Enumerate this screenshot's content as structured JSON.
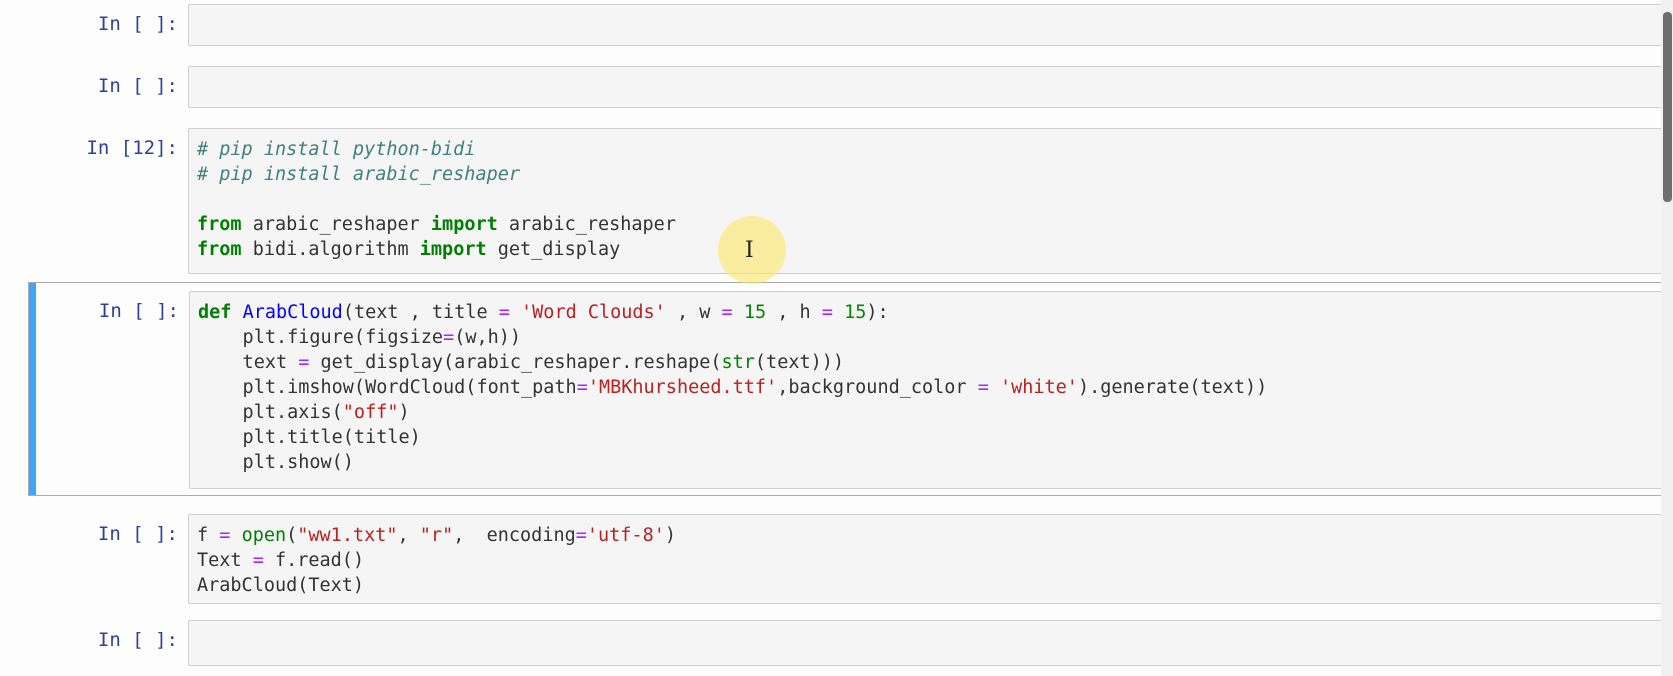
{
  "cells": [
    {
      "prompt": "In [ ]:",
      "lines": []
    },
    {
      "prompt": "In [ ]:",
      "lines": []
    },
    {
      "prompt": "In [12]:",
      "lines": [
        [
          {
            "t": "# pip install python-bidi",
            "c": "comment"
          }
        ],
        [
          {
            "t": "# pip install arabic_reshaper",
            "c": "comment"
          }
        ],
        [
          {
            "t": "",
            "c": ""
          }
        ],
        [
          {
            "t": "from",
            "c": "keyword"
          },
          {
            "t": " arabic_reshaper ",
            "c": ""
          },
          {
            "t": "import",
            "c": "keyword"
          },
          {
            "t": " arabic_reshaper",
            "c": ""
          }
        ],
        [
          {
            "t": "from",
            "c": "keyword"
          },
          {
            "t": " bidi.algorithm ",
            "c": ""
          },
          {
            "t": "import",
            "c": "keyword"
          },
          {
            "t": " get_display",
            "c": ""
          }
        ]
      ]
    },
    {
      "prompt": "In [ ]:",
      "selected": true,
      "lines": [
        [
          {
            "t": "def",
            "c": "keyword"
          },
          {
            "t": " ",
            "c": ""
          },
          {
            "t": "ArabCloud",
            "c": "def"
          },
          {
            "t": "(text , title ",
            "c": ""
          },
          {
            "t": "=",
            "c": "op"
          },
          {
            "t": " ",
            "c": ""
          },
          {
            "t": "'Word Clouds'",
            "c": "string"
          },
          {
            "t": " , w ",
            "c": ""
          },
          {
            "t": "=",
            "c": "op"
          },
          {
            "t": " ",
            "c": ""
          },
          {
            "t": "15",
            "c": "number"
          },
          {
            "t": " , h ",
            "c": ""
          },
          {
            "t": "=",
            "c": "op"
          },
          {
            "t": " ",
            "c": ""
          },
          {
            "t": "15",
            "c": "number"
          },
          {
            "t": "):",
            "c": ""
          }
        ],
        [
          {
            "t": "    plt.figure(figsize",
            "c": ""
          },
          {
            "t": "=",
            "c": "op"
          },
          {
            "t": "(w,h))",
            "c": ""
          }
        ],
        [
          {
            "t": "    text ",
            "c": ""
          },
          {
            "t": "=",
            "c": "op"
          },
          {
            "t": " get_display(arabic_reshaper.reshape(",
            "c": ""
          },
          {
            "t": "str",
            "c": "builtin"
          },
          {
            "t": "(text)))",
            "c": ""
          }
        ],
        [
          {
            "t": "    plt.imshow(WordCloud(font_path",
            "c": ""
          },
          {
            "t": "=",
            "c": "op"
          },
          {
            "t": "'MBKhursheed.ttf'",
            "c": "string"
          },
          {
            "t": ",background_color ",
            "c": ""
          },
          {
            "t": "=",
            "c": "op"
          },
          {
            "t": " ",
            "c": ""
          },
          {
            "t": "'white'",
            "c": "string"
          },
          {
            "t": ").generate(text))",
            "c": ""
          }
        ],
        [
          {
            "t": "    plt.axis(",
            "c": ""
          },
          {
            "t": "\"off\"",
            "c": "string"
          },
          {
            "t": ")",
            "c": ""
          }
        ],
        [
          {
            "t": "    plt.title(title)",
            "c": ""
          }
        ],
        [
          {
            "t": "    plt.show()",
            "c": ""
          }
        ]
      ]
    },
    {
      "prompt": "In [ ]:",
      "lines": [
        [
          {
            "t": "f ",
            "c": ""
          },
          {
            "t": "=",
            "c": "op"
          },
          {
            "t": " ",
            "c": ""
          },
          {
            "t": "open",
            "c": "builtin"
          },
          {
            "t": "(",
            "c": ""
          },
          {
            "t": "\"ww1.txt\"",
            "c": "string"
          },
          {
            "t": ", ",
            "c": ""
          },
          {
            "t": "\"r\"",
            "c": "string"
          },
          {
            "t": ",  encoding",
            "c": ""
          },
          {
            "t": "=",
            "c": "op"
          },
          {
            "t": "'utf-8'",
            "c": "string"
          },
          {
            "t": ")",
            "c": ""
          }
        ],
        [
          {
            "t": "Text ",
            "c": ""
          },
          {
            "t": "=",
            "c": "op"
          },
          {
            "t": " f.read()",
            "c": ""
          }
        ],
        [
          {
            "t": "ArabCloud(Text)",
            "c": ""
          }
        ]
      ]
    },
    {
      "prompt": "In [ ]:",
      "lines": []
    }
  ],
  "cursor": {
    "icon": "text-cursor-icon",
    "glyph": "I",
    "highlight_color": "#ffe65a"
  }
}
